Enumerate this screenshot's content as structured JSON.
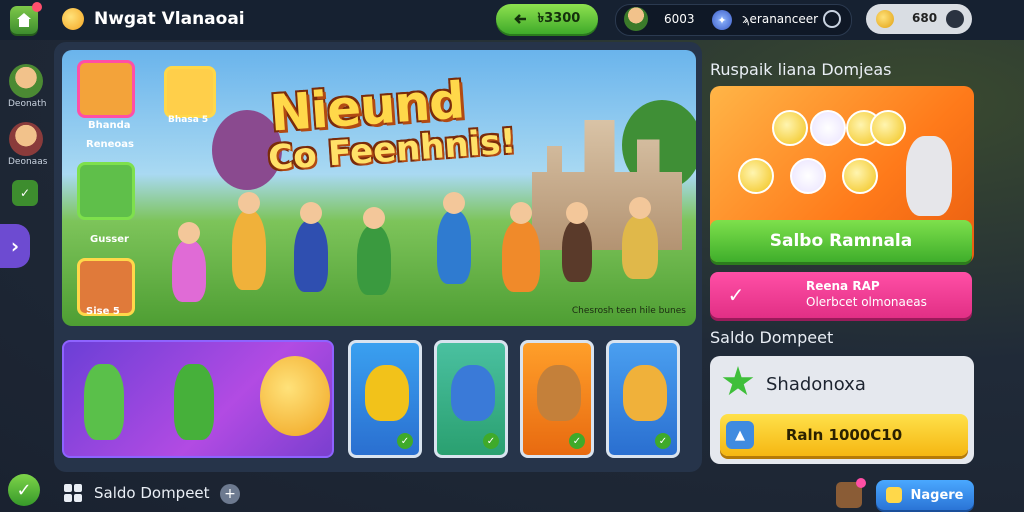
{
  "header": {
    "title": "Nwgat Vlanaoai",
    "green_button": "৳3300",
    "status_value_1": "6003",
    "status_value_2": "ϡerananceer",
    "coins": "680"
  },
  "sidebar": {
    "items": [
      {
        "label": "Deonath"
      },
      {
        "label": "Deonaas"
      }
    ]
  },
  "banner": {
    "title": "Nieund",
    "subtitle": "Co Feenhnis!",
    "caption": "Chesrosh teen hile bunes",
    "tiles": [
      {
        "label": "Bhanda"
      },
      {
        "label": "Reneoas"
      },
      {
        "label": "Gusser"
      },
      {
        "label": "Sise 5"
      }
    ],
    "tile_extra": "Bhasa 5"
  },
  "right_panel": {
    "heading": "Ruspaik liana Domjeas",
    "green_button": "Salbo Ramnala",
    "pink_line_1": "Reena RAP",
    "pink_line_2": "Olerbcet olmonaeas",
    "section_title": "Saldo Dompeet",
    "card_name": "Shadonoxa",
    "yellow_button": "Raln 1000C10"
  },
  "footer": {
    "label": "Saldo Dompeet",
    "blue_button": "Nagere"
  },
  "colors": {
    "accent_green": "#3faa2a",
    "accent_pink": "#e22f85",
    "accent_orange": "#ff7a1a",
    "accent_purple": "#6d4bd1"
  },
  "icons": [
    "home-icon",
    "coin-icon",
    "gear-icon",
    "clock-icon",
    "star-icon",
    "check-icon",
    "plus-icon",
    "gift-icon",
    "grid-icon",
    "chevron-right-icon"
  ]
}
